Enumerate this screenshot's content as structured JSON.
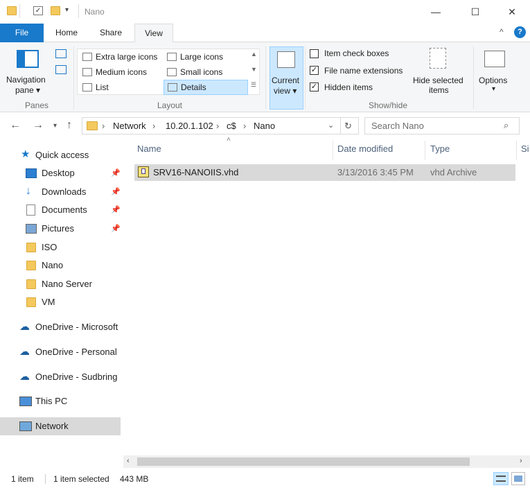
{
  "titlebar": {
    "title": "Nano",
    "minimize": "—",
    "maximize": "☐",
    "close": "✕"
  },
  "tabs": {
    "file": "File",
    "home": "Home",
    "share": "Share",
    "view": "View"
  },
  "ribbon": {
    "panes": {
      "navigation_pane": "Navigation",
      "navigation_pane_2": "pane ▾",
      "group_label": "Panes"
    },
    "layout": {
      "items": [
        "Extra large icons",
        "Large icons",
        "Medium icons",
        "Small icons",
        "List",
        "Details"
      ],
      "group_label": "Layout"
    },
    "current_view": {
      "line1": "Current",
      "line2": "view ▾"
    },
    "show_hide": {
      "item_check_boxes": "Item check boxes",
      "file_name_extensions": "File name extensions",
      "hidden_items": "Hidden items",
      "hide_selected_1": "Hide selected",
      "hide_selected_2": "items",
      "group_label": "Show/hide",
      "checked": {
        "item_check_boxes": false,
        "file_name_extensions": true,
        "hidden_items": true
      }
    },
    "options": {
      "label": "Options",
      "arrow": "▾"
    }
  },
  "address": {
    "crumbs": [
      "Network",
      "10.20.1.102",
      "c$",
      "Nano"
    ],
    "search_placeholder": "Search Nano"
  },
  "navpane": {
    "quick_access": "Quick access",
    "pinned": [
      "Desktop",
      "Downloads",
      "Documents",
      "Pictures"
    ],
    "folders": [
      "ISO",
      "Nano",
      "Nano Server",
      "VM"
    ],
    "onedrive": [
      "OneDrive - Microsoft",
      "OneDrive - Personal",
      "OneDrive - Sudbring"
    ],
    "this_pc": "This PC",
    "network": "Network"
  },
  "columns": {
    "name": "Name",
    "date_modified": "Date modified",
    "type": "Type",
    "size": "Si"
  },
  "files": [
    {
      "name": "SRV16-NANOIIS.vhd",
      "date_modified": "3/13/2016 3:45 PM",
      "type": "vhd Archive"
    }
  ],
  "status": {
    "count": "1 item",
    "selected": "1 item selected",
    "size": "443 MB"
  },
  "colors": {
    "file_tab": "#1979ca",
    "selection": "#cce8ff",
    "nav_selected": "#d9d9d9"
  }
}
